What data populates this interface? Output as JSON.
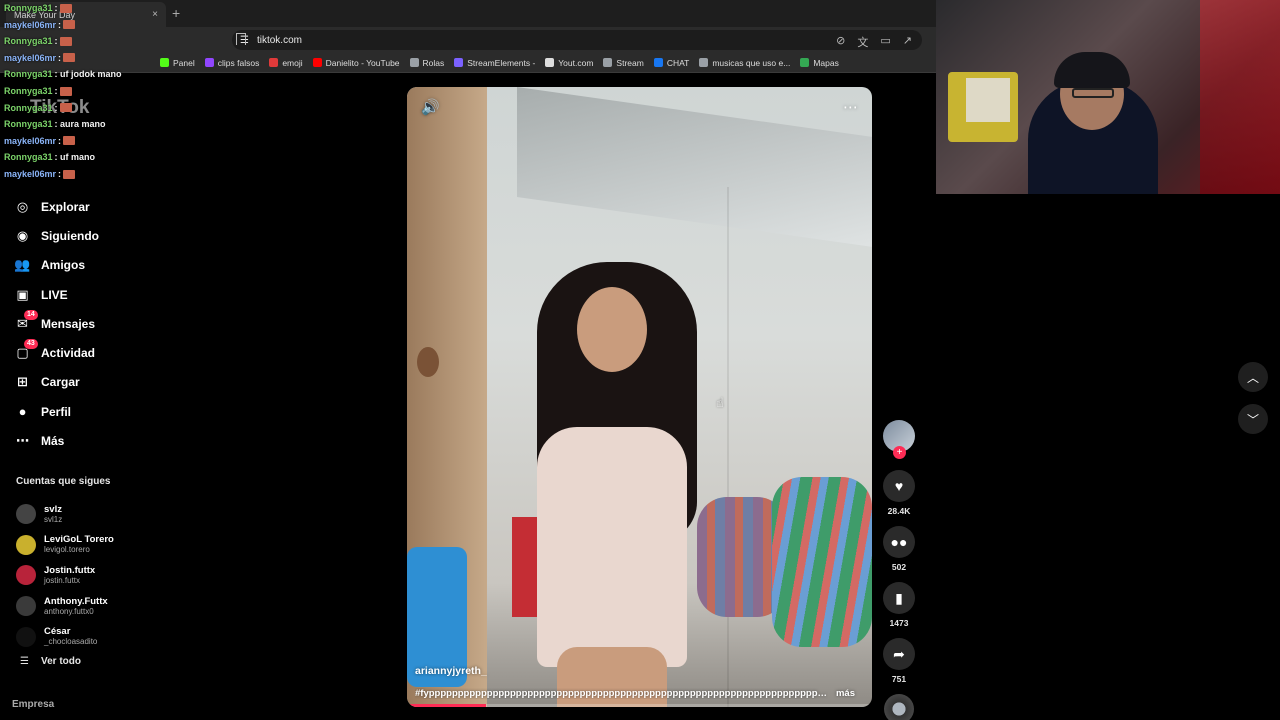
{
  "browser": {
    "tab_title": "Make Your Day",
    "tab_close": "×",
    "new_tab": "+",
    "url": "tiktok.com",
    "bookmarks": [
      {
        "label": "Panel",
        "icon": "kick-icon",
        "color": "#53fc18"
      },
      {
        "label": "clips falsos",
        "icon": "twitch-icon",
        "color": "#9146ff"
      },
      {
        "label": "emoji",
        "icon": "lightning-icon",
        "color": "#e03a3a"
      },
      {
        "label": "Danielito - YouTube",
        "icon": "youtube-icon",
        "color": "#ff0000"
      },
      {
        "label": "Rolas",
        "icon": "folder-icon",
        "color": "#9aa0a6"
      },
      {
        "label": "StreamElements -",
        "icon": "streamelements-icon",
        "color": "#7b61ff"
      },
      {
        "label": "Yout.com",
        "icon": "yout-icon",
        "color": "#dddddd"
      },
      {
        "label": "Stream",
        "icon": "folder-icon",
        "color": "#9aa0a6"
      },
      {
        "label": "CHAT",
        "icon": "facebook-icon",
        "color": "#1877f2"
      },
      {
        "label": "musicas que uso e...",
        "icon": "folder-icon",
        "color": "#9aa0a6"
      },
      {
        "label": "Mapas",
        "icon": "maps-icon",
        "color": "#34a853"
      }
    ]
  },
  "chat": [
    {
      "user": "Ronnyga31",
      "msg": ":",
      "color": "green"
    },
    {
      "user": "maykel06mr",
      "msg": ":",
      "color": "blue"
    },
    {
      "user": "Ronnyga31",
      "msg": ":",
      "color": "green"
    },
    {
      "user": "maykel06mr",
      "msg": ":",
      "color": "blue"
    },
    {
      "user": "Ronnyga31",
      "msg": ": uf jodok mano",
      "color": "green"
    },
    {
      "user": "Ronnyga31",
      "msg": ":",
      "color": "green"
    },
    {
      "user": "Ronnyga31",
      "msg": ":",
      "color": "green"
    },
    {
      "user": "Ronnyga31",
      "msg": ": aura mano",
      "color": "green"
    },
    {
      "user": "maykel06mr",
      "msg": ":",
      "color": "blue"
    },
    {
      "user": "Ronnyga31",
      "msg": ": uf mano",
      "color": "green"
    },
    {
      "user": "maykel06mr",
      "msg": ":",
      "color": "blue"
    }
  ],
  "sidebar": {
    "logo": "TikTok",
    "nav": [
      {
        "label": "Explorar",
        "icon": "compass-icon",
        "glyph": "◎"
      },
      {
        "label": "Siguiendo",
        "icon": "following-icon",
        "glyph": "◉"
      },
      {
        "label": "Amigos",
        "icon": "friends-icon",
        "glyph": "👥"
      },
      {
        "label": "LIVE",
        "icon": "live-icon",
        "glyph": "▣"
      },
      {
        "label": "Mensajes",
        "icon": "messages-icon",
        "glyph": "✉",
        "badge": "14"
      },
      {
        "label": "Actividad",
        "icon": "activity-icon",
        "glyph": "▢",
        "badge": "43"
      },
      {
        "label": "Cargar",
        "icon": "upload-icon",
        "glyph": "⊞"
      },
      {
        "label": "Perfil",
        "icon": "profile-icon",
        "glyph": "●"
      },
      {
        "label": "Más",
        "icon": "more-icon",
        "glyph": "⋯"
      }
    ],
    "following_title": "Cuentas que sigues",
    "following": [
      {
        "name": "svlz",
        "user": "svl1z",
        "color": "#444444"
      },
      {
        "name": "LeviGoL Torero",
        "user": "levigol.torero",
        "color": "#c9b02d"
      },
      {
        "name": "Jostin.futtx",
        "user": "jostin.futtx",
        "color": "#b8233a"
      },
      {
        "name": "Anthony.Futtx",
        "user": "anthony.futtx0",
        "color": "#3a3a3a"
      },
      {
        "name": "César",
        "user": "_chocloasadito",
        "color": "#111111"
      }
    ],
    "see_all": "Ver todo",
    "empresa": "Empresa"
  },
  "video": {
    "username": "ariannyjyreth_",
    "caption": "#fypppppppppppppppppppppppppppppppppppppppppppppppppppppppppppppppppppppppppppp...",
    "more": "más",
    "progress": 0.17
  },
  "actions": {
    "likes": "28.4K",
    "comments": "502",
    "saves": "1473",
    "shares": "751"
  }
}
